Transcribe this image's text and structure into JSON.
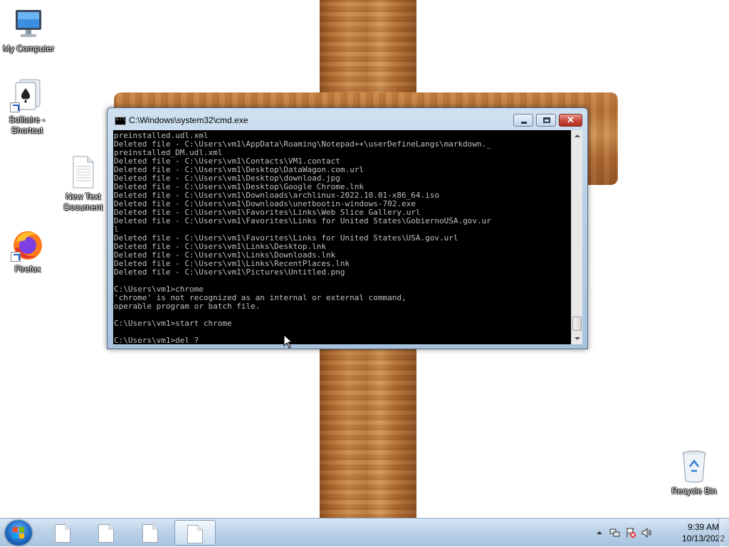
{
  "desktop": {
    "icons": [
      {
        "label": "My Computer"
      },
      {
        "label": "Solitaire - Shortcut"
      },
      {
        "label": "New Text Document"
      },
      {
        "label": "Firefox"
      },
      {
        "label": "Recycle Bin"
      }
    ]
  },
  "window": {
    "title": "C:\\Windows\\system32\\cmd.exe",
    "close_glyph": "✕",
    "console_lines": [
      "preinstalled.udl.xml",
      "Deleted file - C:\\Users\\vm1\\AppData\\Roaming\\Notepad++\\userDefineLangs\\markdown._",
      "preinstalled_DM.udl.xml",
      "Deleted file - C:\\Users\\vm1\\Contacts\\VM1.contact",
      "Deleted file - C:\\Users\\vm1\\Desktop\\DataWagon.com.url",
      "Deleted file - C:\\Users\\vm1\\Desktop\\download.jpg",
      "Deleted file - C:\\Users\\vm1\\Desktop\\Google Chrome.lnk",
      "Deleted file - C:\\Users\\vm1\\Downloads\\archlinux-2022.10.01-x86_64.iso",
      "Deleted file - C:\\Users\\vm1\\Downloads\\unetbootin-windows-702.exe",
      "Deleted file - C:\\Users\\vm1\\Favorites\\Links\\Web Slice Gallery.url",
      "Deleted file - C:\\Users\\vm1\\Favorites\\Links for United States\\GobiernoUSA.gov.ur",
      "l",
      "Deleted file - C:\\Users\\vm1\\Favorites\\Links for United States\\USA.gov.url",
      "Deleted file - C:\\Users\\vm1\\Links\\Desktop.lnk",
      "Deleted file - C:\\Users\\vm1\\Links\\Downloads.lnk",
      "Deleted file - C:\\Users\\vm1\\Links\\RecentPlaces.lnk",
      "Deleted file - C:\\Users\\vm1\\Pictures\\Untitled.png",
      "",
      "C:\\Users\\vm1>chrome",
      "'chrome' is not recognized as an internal or external command,",
      "operable program or batch file.",
      "",
      "C:\\Users\\vm1>start chrome",
      "",
      "C:\\Users\\vm1>del ?"
    ]
  },
  "taskbar": {
    "buttons": [
      {
        "icon": "text-document-icon"
      },
      {
        "icon": "text-document-icon"
      },
      {
        "icon": "text-document-icon"
      },
      {
        "icon": "text-document-icon",
        "active": true
      }
    ],
    "clock": {
      "time": "9:39 AM",
      "date": "10/13/2022"
    }
  }
}
